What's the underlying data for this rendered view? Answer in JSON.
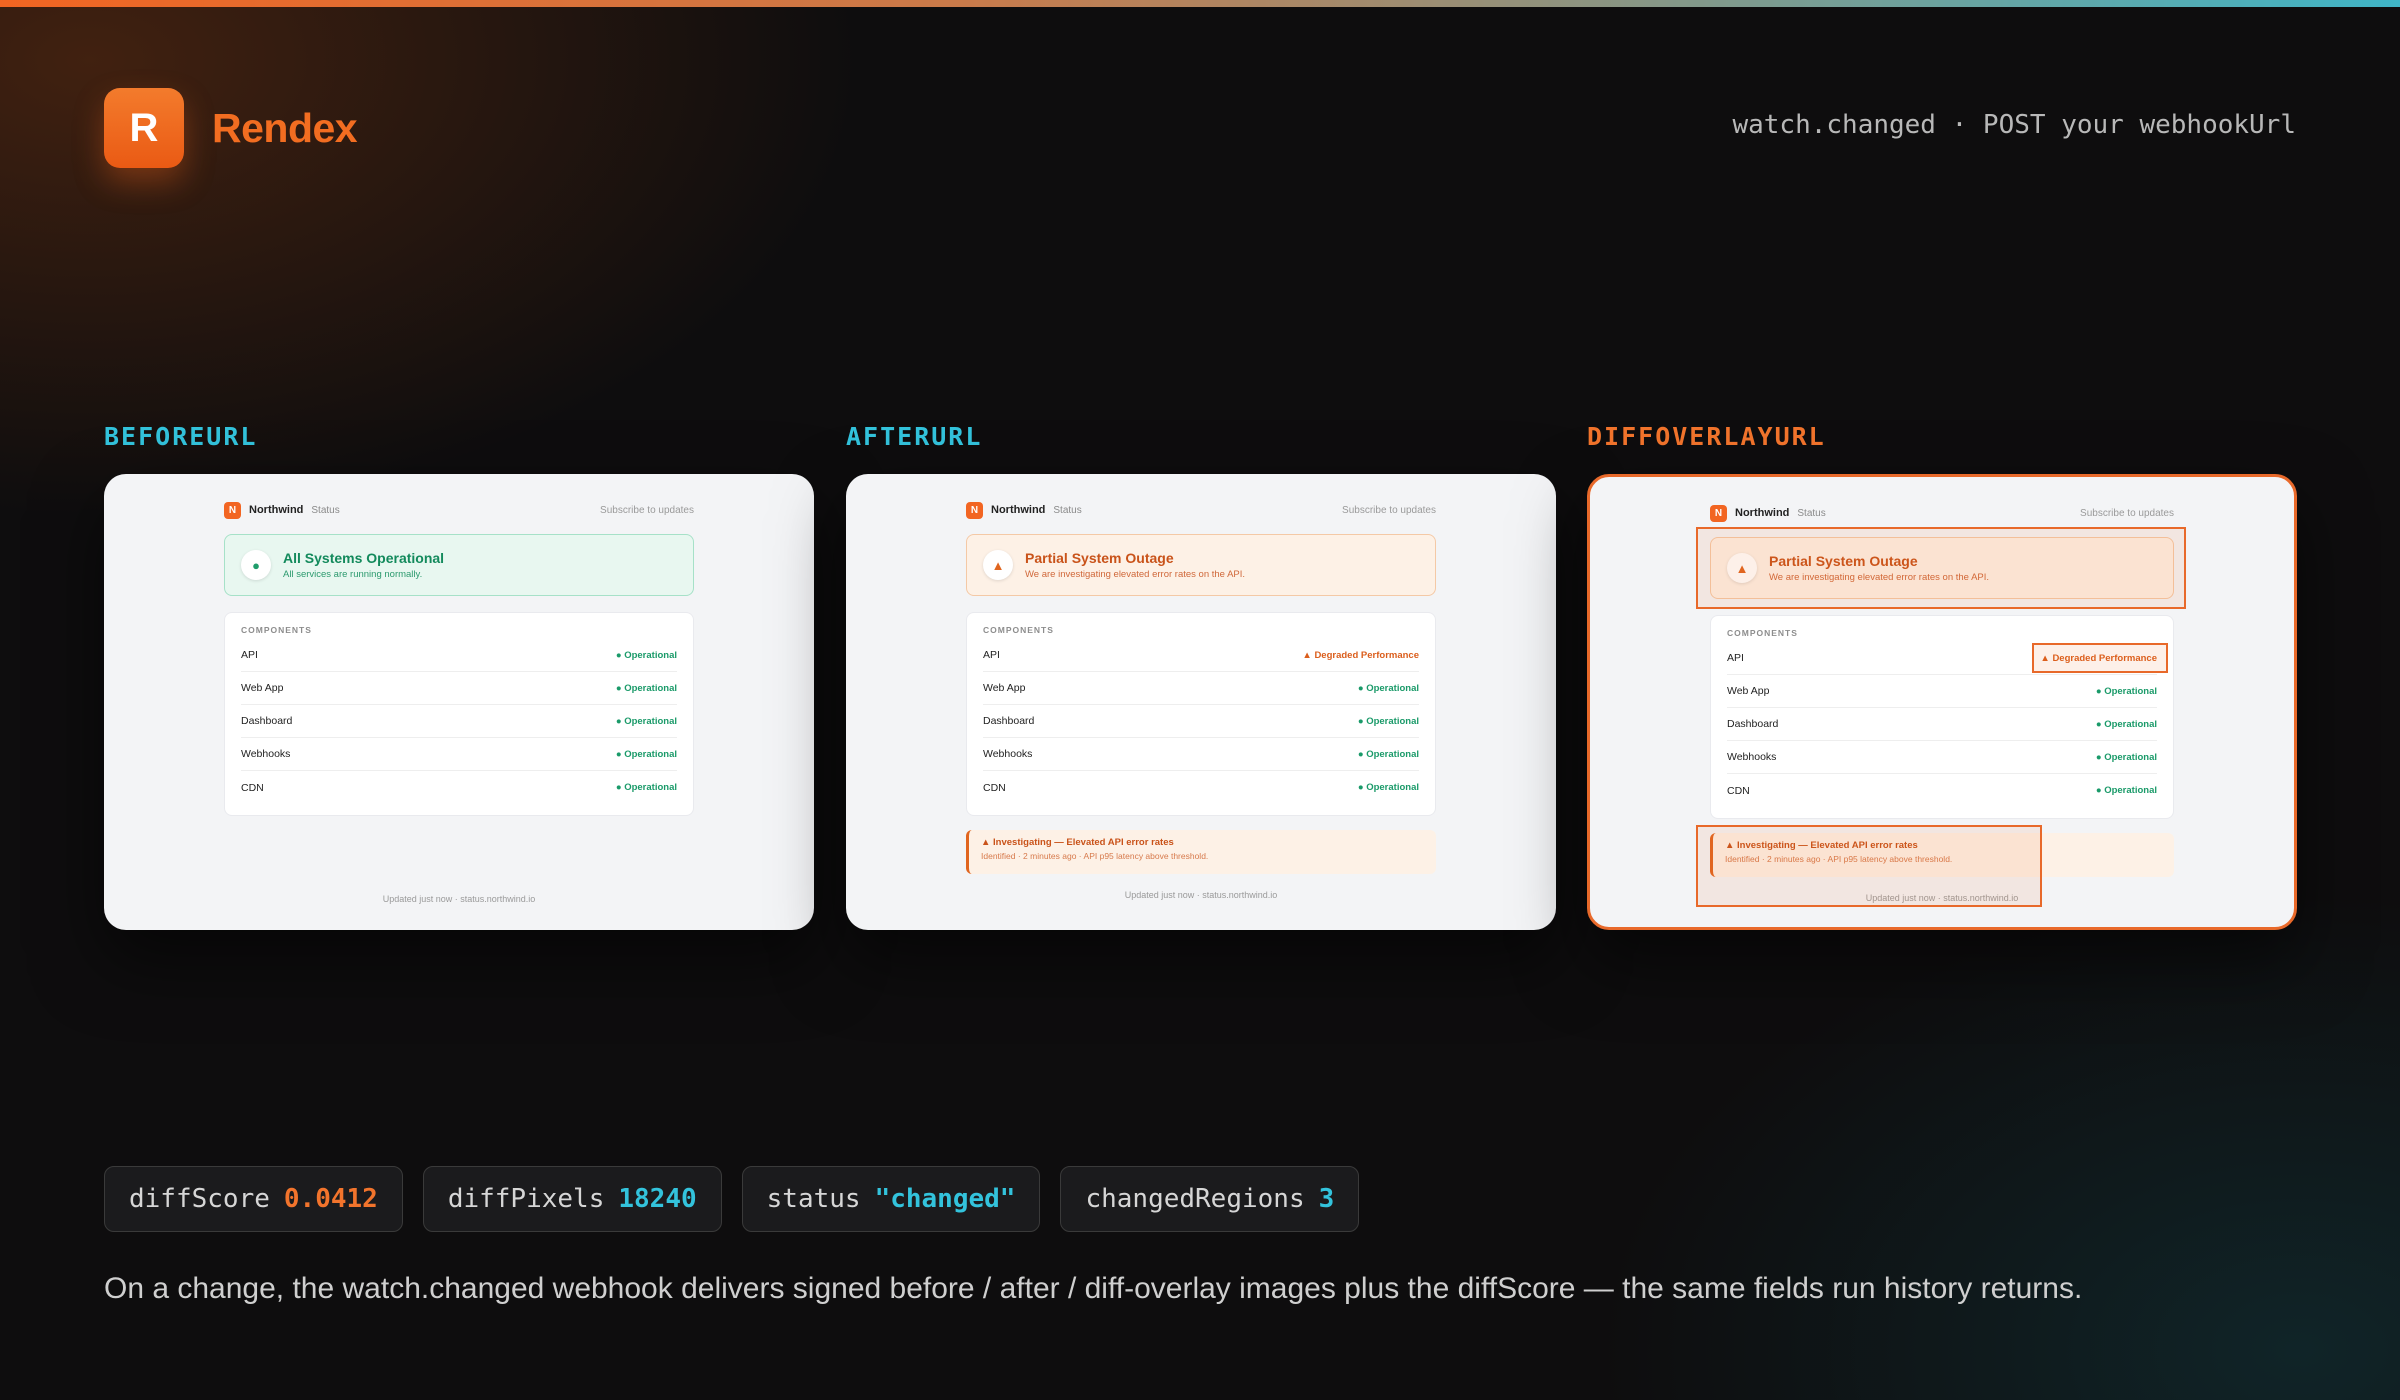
{
  "brand": {
    "logo_letter": "R",
    "name": "Rendex"
  },
  "header": {
    "event_text": "watch.changed · POST your webhookUrl"
  },
  "panels": [
    {
      "label": "BEFOREURL",
      "variant": "before"
    },
    {
      "label": "AFTERURL",
      "variant": "after"
    },
    {
      "label": "DIFFOVERLAYURL",
      "variant": "diff"
    }
  ],
  "status_page": {
    "logo_letter": "N",
    "brand": "Northwind",
    "brand_sub": "Status",
    "subscribe": "Subscribe to updates",
    "components_title": "COMPONENTS",
    "components": [
      "API",
      "Web App",
      "Dashboard",
      "Webhooks",
      "CDN"
    ],
    "before": {
      "banner_icon": "●",
      "banner_title": "All Systems Operational",
      "banner_desc": "All services are running normally.",
      "statuses": [
        "● Operational",
        "● Operational",
        "● Operational",
        "● Operational",
        "● Operational"
      ],
      "footer": "Updated just now · status.northwind.io"
    },
    "after": {
      "banner_icon": "▲",
      "banner_title": "Partial System Outage",
      "banner_desc": "We are investigating elevated error rates on the API.",
      "statuses": [
        "▲ Degraded Performance",
        "● Operational",
        "● Operational",
        "● Operational",
        "● Operational"
      ],
      "incident_title": "▲ Investigating — Elevated API error rates",
      "incident_desc": "Identified · 2 minutes ago · API p95 latency above threshold.",
      "footer": "Updated just now · status.northwind.io"
    }
  },
  "metrics": [
    {
      "key": "diffScore",
      "value": "0.0412",
      "color": "orange"
    },
    {
      "key": "diffPixels",
      "value": "18240",
      "color": "cyan"
    },
    {
      "key": "status",
      "value": "\"changed\"",
      "color": "cyan"
    },
    {
      "key": "changedRegions",
      "value": "3",
      "color": "cyan"
    }
  ],
  "caption": "On a change, the watch.changed webhook delivers signed before / after / diff-overlay images plus the diffScore — the same fields run history returns.",
  "colors": {
    "accent_orange": "#f26522",
    "accent_cyan": "#33c3dc",
    "ok_green": "#1a9a69",
    "warn_orange": "#db5e1c"
  }
}
